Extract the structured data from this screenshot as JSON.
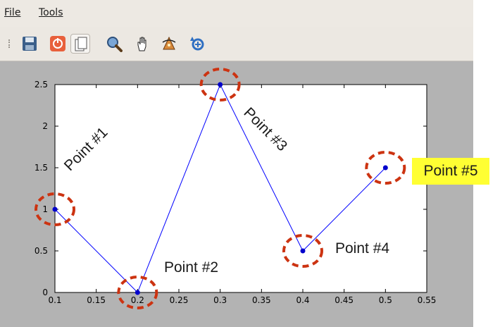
{
  "menu": {
    "file_label": "File",
    "tools_label": "Tools"
  },
  "toolbar": {
    "icons": [
      "save-icon",
      "stop-icon",
      "copy-icon",
      "zoom-icon",
      "pan-hand-icon",
      "rotate-3d-icon",
      "reset-view-icon"
    ]
  },
  "chart_data": {
    "type": "line",
    "x": [
      0.1,
      0.2,
      0.3,
      0.4,
      0.5
    ],
    "y": [
      1,
      0,
      2.5,
      0.5,
      1.5
    ],
    "xlim": [
      0.1,
      0.55
    ],
    "ylim": [
      0,
      2.5
    ],
    "xticks": [
      "0.1",
      "0.15",
      "0.2",
      "0.25",
      "0.3",
      "0.35",
      "0.4",
      "0.45",
      "0.5",
      "0.55"
    ],
    "yticks": [
      "0",
      "0.5",
      "1",
      "1.5",
      "2",
      "2.5"
    ],
    "line_color": "#0000ff",
    "marker_color": "#0000cc",
    "highlight_color": "#cc3311",
    "annotations": [
      "Point #1",
      "Point #2",
      "Point #3",
      "Point #4",
      "Point #5"
    ],
    "grid": false
  }
}
